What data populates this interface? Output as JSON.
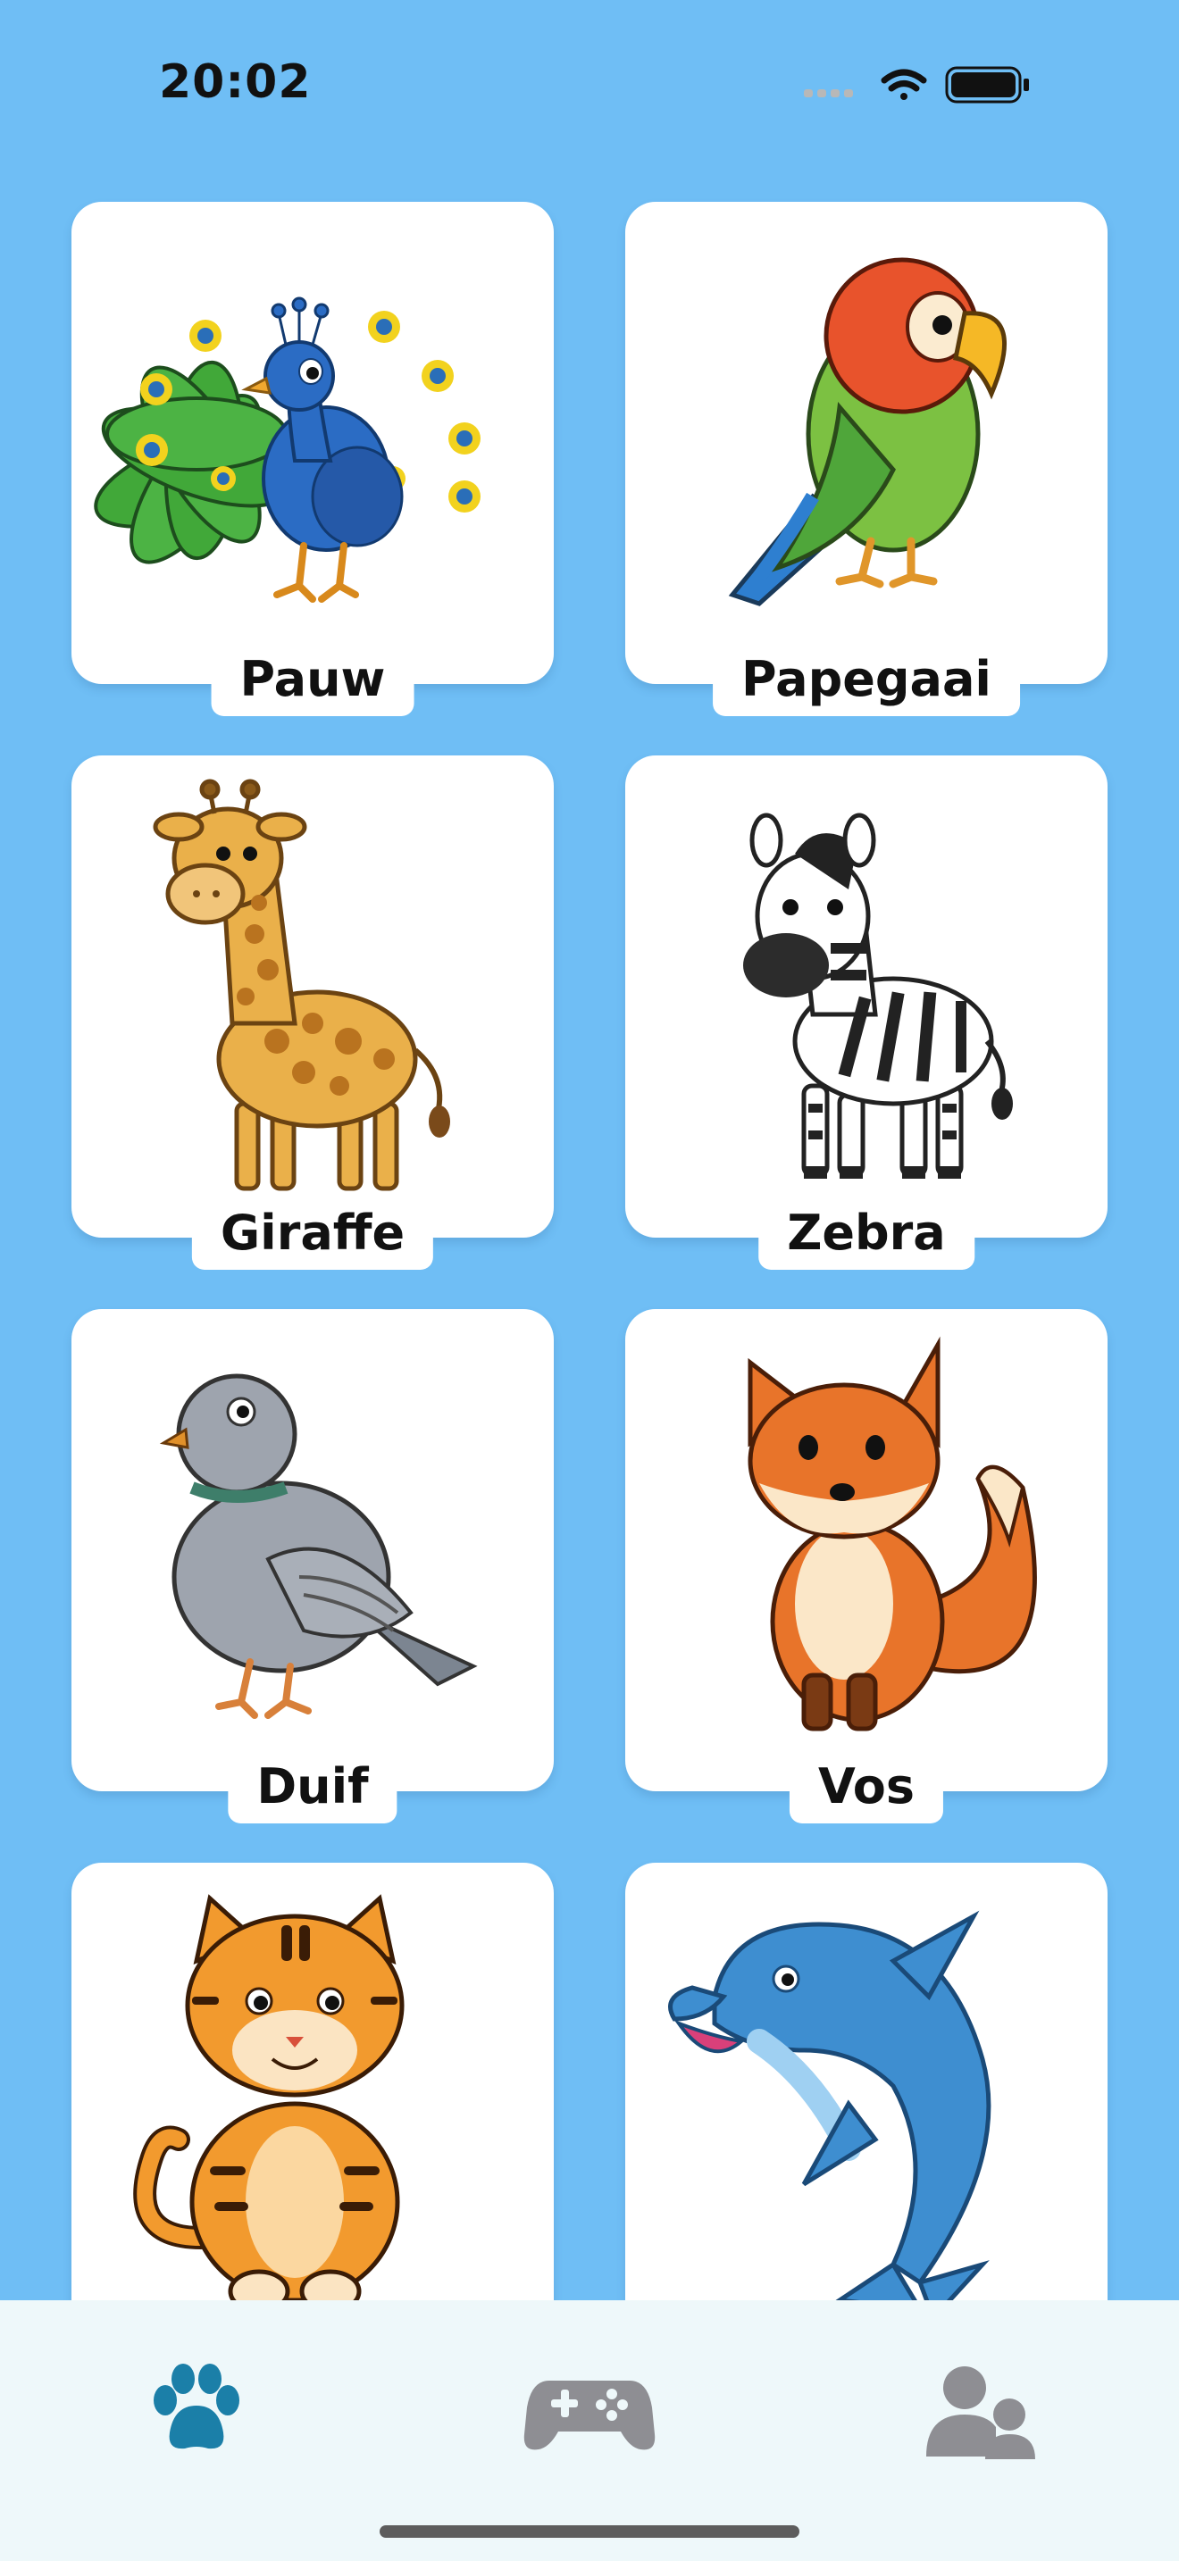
{
  "status_bar": {
    "time": "20:02",
    "icons": [
      "signal-dots-icon",
      "wifi-icon",
      "battery-icon"
    ]
  },
  "animals": [
    {
      "name": "Pauw",
      "icon": "peacock-illustration"
    },
    {
      "name": "Papegaai",
      "icon": "parrot-illustration"
    },
    {
      "name": "Giraffe",
      "icon": "giraffe-illustration"
    },
    {
      "name": "Zebra",
      "icon": "zebra-illustration"
    },
    {
      "name": "Duif",
      "icon": "pigeon-illustration"
    },
    {
      "name": "Vos",
      "icon": "fox-illustration"
    },
    {
      "name": "",
      "icon": "tiger-illustration"
    },
    {
      "name": "",
      "icon": "dolphin-illustration"
    }
  ],
  "tab_bar": {
    "tabs": [
      {
        "id": "animals",
        "icon": "paw-icon",
        "active": true
      },
      {
        "id": "games",
        "icon": "gamepad-icon",
        "active": false
      },
      {
        "id": "profiles",
        "icon": "users-icon",
        "active": false
      }
    ]
  },
  "colors": {
    "background": "#6FBEF5",
    "card": "#FFFFFF",
    "tab_bar": "#EEF8FA",
    "active_tab": "#1B7FA8",
    "inactive_tab": "#8E8E93"
  }
}
